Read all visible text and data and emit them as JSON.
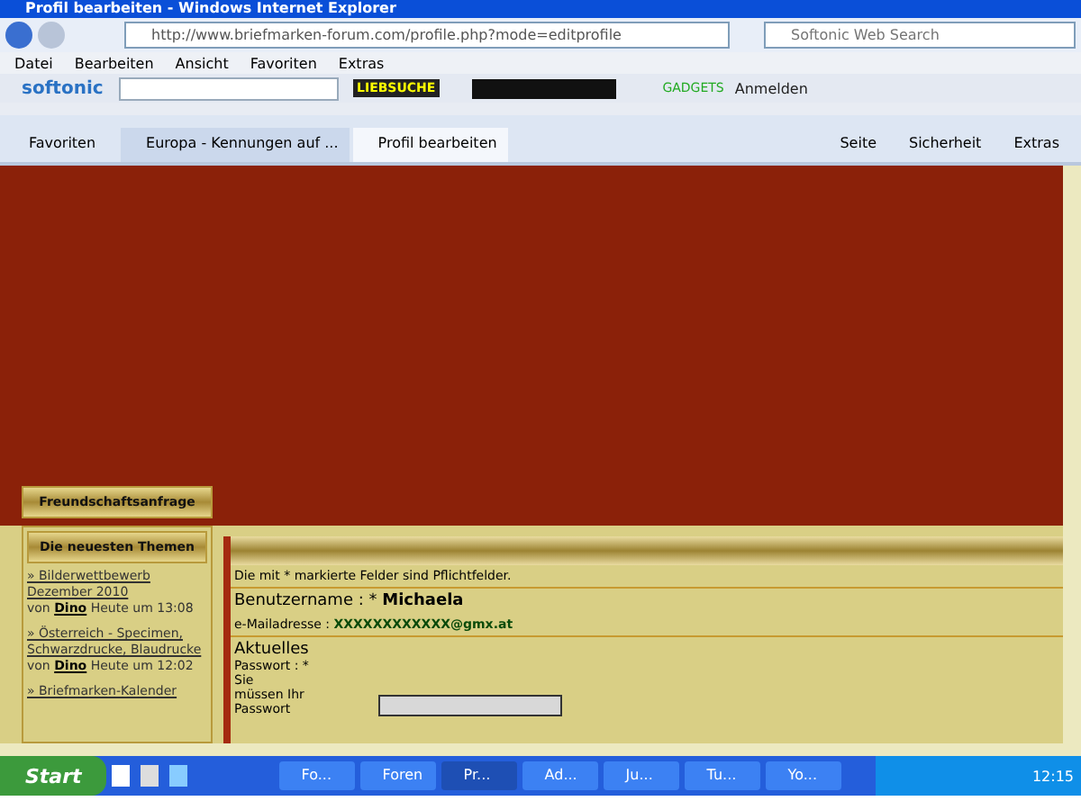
{
  "window": {
    "title": "Profil bearbeiten - Windows Internet Explorer"
  },
  "address_bar": {
    "url": "http://www.briefmarken-forum.com/profile.php?mode=editprofile"
  },
  "search": {
    "placeholder": "Softonic Web Search"
  },
  "menu": [
    "Datei",
    "Bearbeiten",
    "Ansicht",
    "Favoriten",
    "Extras"
  ],
  "toolbar": {
    "brand": "softonic",
    "search_button": "LIEBSUCHE",
    "gadgets": "GADGETS",
    "signin": "Anmelden"
  },
  "favorites": "Favoriten",
  "tabs": [
    {
      "label": "Europa - Kennungen auf ...",
      "selected": false
    },
    {
      "label": "Profil bearbeiten",
      "selected": true
    }
  ],
  "commands": [
    "Seite",
    "Sicherheit",
    "Extras"
  ],
  "sidebar": {
    "friend_request": "Freundschaftsanfrage",
    "latest_title": "Die neuesten Themen",
    "topics": [
      {
        "title": "» Bilderwettbewerb Dezember 2010",
        "by": "von",
        "author": "Dino",
        "time": "Heute um 13:08"
      },
      {
        "title": "» Österreich - Specimen, Schwarzdrucke, Blaudrucke",
        "by": "von",
        "author": "Dino",
        "time": "Heute um 12:02"
      },
      {
        "title": "» Briefmarken-Kalender"
      }
    ]
  },
  "form": {
    "note": "Die mit * markierte Felder sind Pflichtfelder.",
    "username_label": "Benutzername : *",
    "username": "Michaela",
    "email_label": "e-Mailadresse :",
    "email": "XXXXXXXXXXXX@gmx.at",
    "section": "Aktuelles",
    "password_label": "Passwort : *",
    "password_hint": "Sie müssen Ihr Passwort"
  },
  "taskbar": {
    "start": "Start",
    "items": [
      {
        "label": "Fo...",
        "selected": false
      },
      {
        "label": "Foren",
        "selected": false
      },
      {
        "label": "Pr...",
        "selected": true
      },
      {
        "label": "Ad...",
        "selected": false
      },
      {
        "label": "Ju...",
        "selected": false
      },
      {
        "label": "Tu...",
        "selected": false
      },
      {
        "label": "Yo...",
        "selected": false
      }
    ],
    "clock": "12:15"
  }
}
